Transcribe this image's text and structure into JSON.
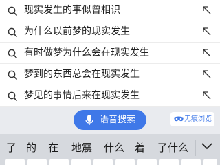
{
  "suggestions": [
    "现实发生的事似曾相识",
    "为什么以前梦的现实发生",
    "有时做梦为什么会在现实发生",
    "梦到的东西总会在现实发生",
    "梦见的事情后来在现实发生"
  ],
  "toolbar": {
    "voice_search_label": "语音搜索",
    "incognito_label": "无痕浏览",
    "accent_color": "#3f78e8"
  },
  "keyboard": {
    "candidates": [
      "了",
      "的",
      "在",
      "地震",
      "什么",
      "着",
      "了什么"
    ]
  },
  "icons": {
    "row_leading": "search-icon",
    "row_trailing": "fill-arrow-icon",
    "voice": "microphone-icon",
    "incognito": "mask-icon",
    "keyboard_collapse": "chevron-down-icon"
  }
}
